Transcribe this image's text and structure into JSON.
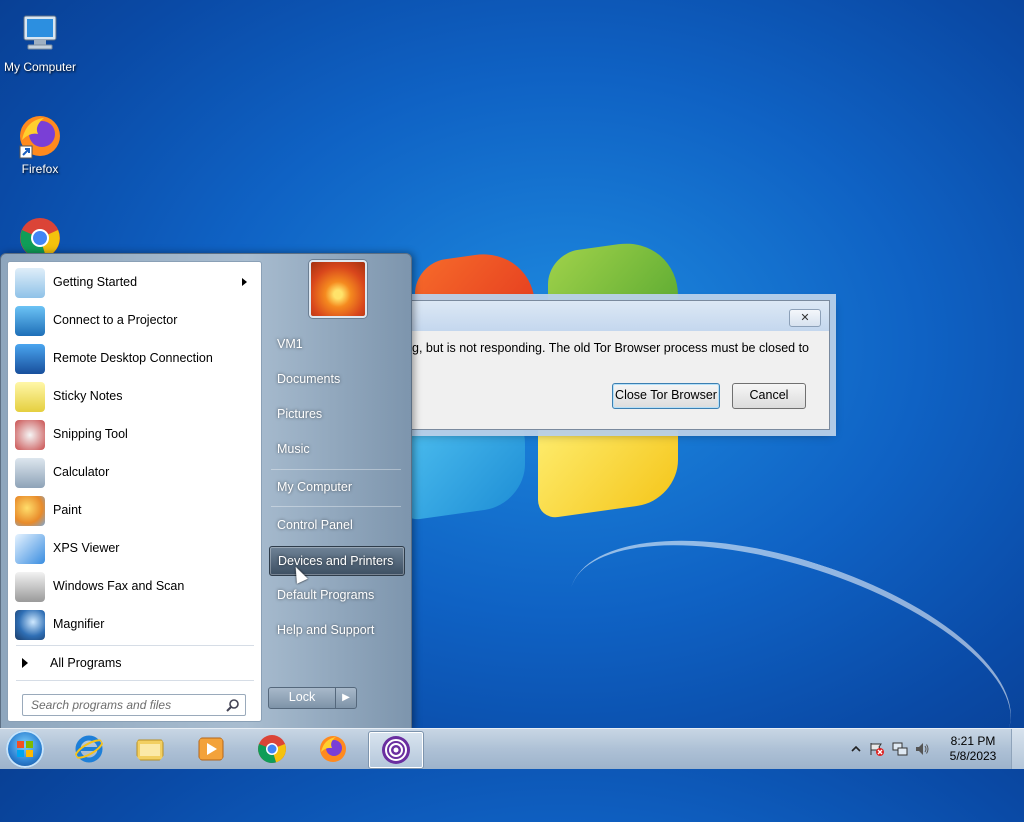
{
  "desktop": {
    "icons": [
      {
        "label": "My Computer"
      },
      {
        "label": "Firefox"
      },
      {
        "label": ""
      }
    ]
  },
  "dialog": {
    "message": "Tor Browser is already running, but is not responding. The old Tor Browser process must be closed to",
    "message_visible": "ning, but is not responding. The old Tor Browser process must be closed to",
    "close_button": "Close Tor Browser",
    "cancel_button": "Cancel",
    "close_glyph": "✕"
  },
  "start_menu": {
    "programs": [
      {
        "label": "Getting Started",
        "icon": "getting-started-icon",
        "submenu": true
      },
      {
        "label": "Connect to a Projector",
        "icon": "projector-icon"
      },
      {
        "label": "Remote Desktop Connection",
        "icon": "remote-desktop-icon"
      },
      {
        "label": "Sticky Notes",
        "icon": "sticky-notes-icon"
      },
      {
        "label": "Snipping Tool",
        "icon": "scissors-icon"
      },
      {
        "label": "Calculator",
        "icon": "calculator-icon"
      },
      {
        "label": "Paint",
        "icon": "paint-palette-icon"
      },
      {
        "label": "XPS Viewer",
        "icon": "xps-viewer-icon"
      },
      {
        "label": "Windows Fax and Scan",
        "icon": "fax-icon"
      },
      {
        "label": "Magnifier",
        "icon": "magnifier-icon"
      }
    ],
    "all_programs": "All Programs",
    "search_placeholder": "Search programs and files",
    "right_items": [
      {
        "label": "VM1"
      },
      {
        "label": "Documents"
      },
      {
        "label": "Pictures"
      },
      {
        "label": "Music"
      },
      {
        "label": "My Computer"
      },
      {
        "label": "Control Panel"
      },
      {
        "label": "Devices and Printers",
        "highlighted": true
      },
      {
        "label": "Default Programs"
      },
      {
        "label": "Help and Support"
      }
    ],
    "lock_button": "Lock"
  },
  "taskbar": {
    "pinned": [
      "internet-explorer-icon",
      "file-explorer-icon",
      "media-player-icon",
      "chrome-icon",
      "firefox-icon",
      "tor-browser-icon"
    ],
    "active": "tor-browser-icon",
    "clock_time": "8:21 PM",
    "clock_date": "5/8/2023"
  },
  "colors": {
    "desktop_blue": "#0f62c4",
    "highlight": "#3d4f62",
    "dialog_default_border": "#3c7fb1"
  }
}
